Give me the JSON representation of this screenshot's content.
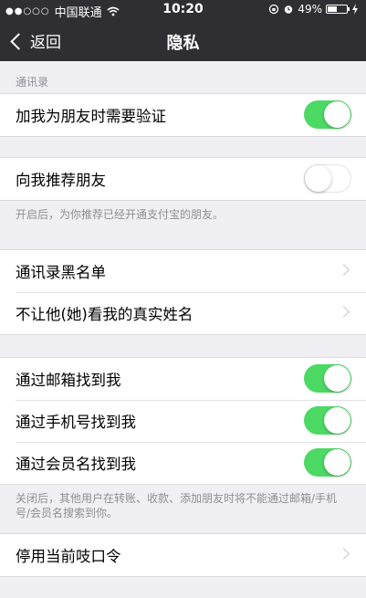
{
  "status_bar": {
    "signal": "●●○○○",
    "carrier": "中国联通",
    "time": "10:20",
    "battery": "49%",
    "battery_level": 0.49
  },
  "nav": {
    "back_label": "返回",
    "title": "隐私"
  },
  "contacts_section": {
    "label": "通讯录",
    "verify_label": "加我为朋友时需要验证",
    "verify_on": true
  },
  "recommend": {
    "label": "向我推荐朋友",
    "on": false,
    "note": "开启后，为你推荐已经开通支付宝的朋友。"
  },
  "lists": {
    "blacklist": "通讯录黑名单",
    "hide_name": "不让他(她)看我的真实姓名"
  },
  "find_me": {
    "email": "通过邮箱找到我",
    "phone": "通过手机号找到我",
    "member": "通过会员名找到我",
    "note": "关闭后，其他用户在转账、收款、添加朋友时将不能通过邮箱/手机号/会员名搜索到你。"
  },
  "passcode": {
    "label": "停用当前吱口令"
  },
  "colors": {
    "toggle_on": "#4cd964",
    "nav_bg": "#2e2e33",
    "page_bg": "#efeff4"
  }
}
